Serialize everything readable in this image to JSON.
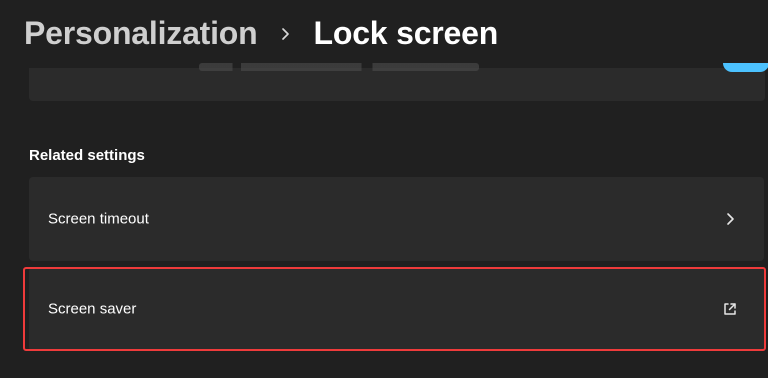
{
  "header": {
    "parent": "Personalization",
    "current": "Lock screen",
    "separator_icon": "chevron-right-icon"
  },
  "partial_card": {
    "toggle_color": "#4cc2ff"
  },
  "related_settings": {
    "title": "Related settings",
    "items": [
      {
        "label": "Screen timeout",
        "trailing_icon": "chevron-right-icon"
      },
      {
        "label": "Screen saver",
        "trailing_icon": "external-link-icon"
      }
    ]
  },
  "colors": {
    "background": "#202020",
    "card": "#2b2b2b",
    "highlight": "#ef3b3b",
    "text": "#ffffff",
    "muted_text": "#cfcfcf"
  }
}
